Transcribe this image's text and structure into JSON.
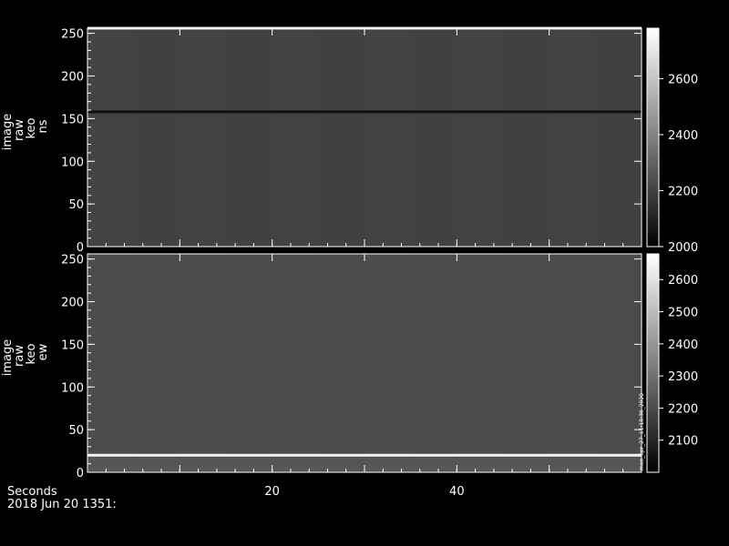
{
  "chart_data": [
    {
      "type": "heatmap",
      "ylabel": [
        "image",
        "raw",
        "keo",
        "ns"
      ],
      "ylim": [
        0,
        256
      ],
      "yticks": [
        0,
        50,
        100,
        150,
        200,
        250
      ],
      "xlim": [
        0,
        60
      ],
      "colorbar": {
        "ticks": [
          2000,
          2200,
          2400,
          2600
        ],
        "range": [
          2000,
          2780
        ]
      },
      "background_level": 2200,
      "bright_rows": [
        {
          "y": 256,
          "value": 2700
        }
      ],
      "dark_rows": [
        {
          "y": 158,
          "value": 2050
        }
      ]
    },
    {
      "type": "heatmap",
      "ylabel": [
        "image",
        "raw",
        "keo",
        "ew"
      ],
      "ylim": [
        0,
        256
      ],
      "yticks": [
        0,
        50,
        100,
        150,
        200,
        250
      ],
      "xlim": [
        0,
        60
      ],
      "colorbar": {
        "ticks": [
          2100,
          2200,
          2300,
          2400,
          2500,
          2600
        ],
        "range": [
          2000,
          2680
        ],
        "side_label": "mon_apr_27_11:18:36_2020"
      },
      "background_level": 2200,
      "bright_rows": [
        {
          "y": 20,
          "value": 2650
        }
      ],
      "dark_rows": []
    }
  ],
  "xaxis": {
    "label": "Seconds",
    "ticks": [
      20,
      40
    ],
    "date_label": "2018 Jun 20 1351:"
  },
  "colors": {
    "background": "#000000",
    "axis": "#ffffff",
    "panel_dark": "#262626",
    "panel_mid": "#2f2f2f"
  }
}
